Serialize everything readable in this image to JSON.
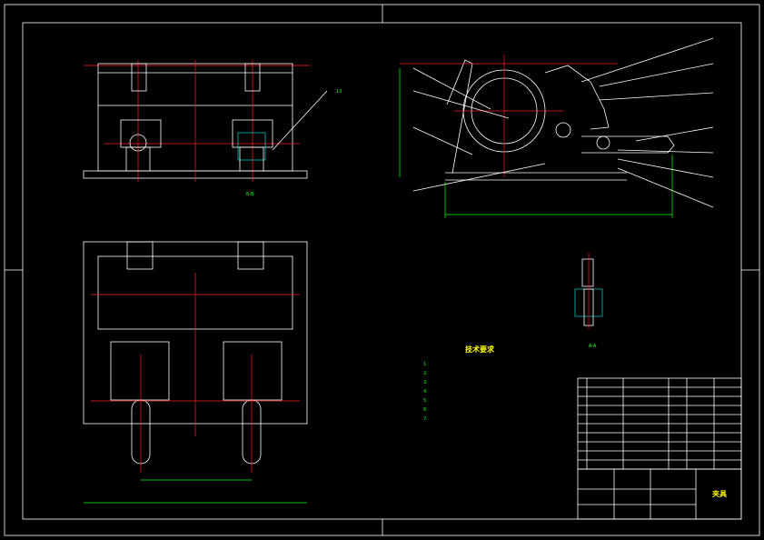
{
  "colors": {
    "background": "#000000",
    "outline": "#ffffff",
    "centerline": "#ff2020",
    "dimension": "#00ff00",
    "hatch": "#00ffff",
    "notes_title": "#ffff00"
  },
  "notes": {
    "title": "技术要求",
    "lines": [
      "1.",
      "2.",
      "3.",
      "4.",
      "5.",
      "6.",
      "7."
    ]
  },
  "title_block": {
    "drawing_title": "夹具"
  }
}
